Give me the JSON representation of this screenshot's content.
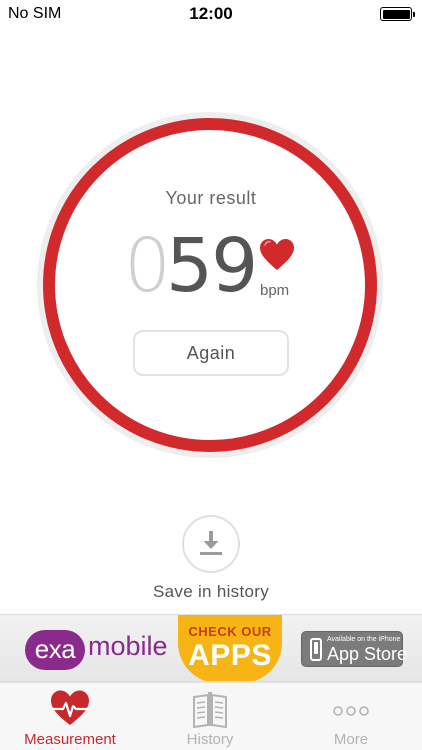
{
  "status_bar": {
    "carrier": "No SIM",
    "time": "12:00",
    "battery_icon": "battery-full-icon"
  },
  "result": {
    "label": "Your result",
    "bpm_leading_zero": "0",
    "bpm_value": "59",
    "unit": "bpm",
    "heart_icon": "heart-icon",
    "again_button": "Again",
    "ring_color": "#d22a2c"
  },
  "save": {
    "icon": "download-icon",
    "label": "Save in history"
  },
  "ad_banner": {
    "brand_prefix": "exa",
    "brand_suffix": "mobile",
    "check_line": "CHECK OUR",
    "apps_line": "APPS",
    "store_small": "Available on the iPhone",
    "store_large": "App Store",
    "brand_color": "#8b2a8d",
    "accent_color": "#f7b515"
  },
  "tab_bar": {
    "tabs": [
      {
        "label": "Measurement",
        "icon": "heart-pulse-icon",
        "active": true
      },
      {
        "label": "History",
        "icon": "book-icon",
        "active": false
      },
      {
        "label": "More",
        "icon": "more-dots-icon",
        "active": false
      }
    ],
    "active_color": "#c8282b",
    "inactive_color": "#b3b3b3"
  }
}
